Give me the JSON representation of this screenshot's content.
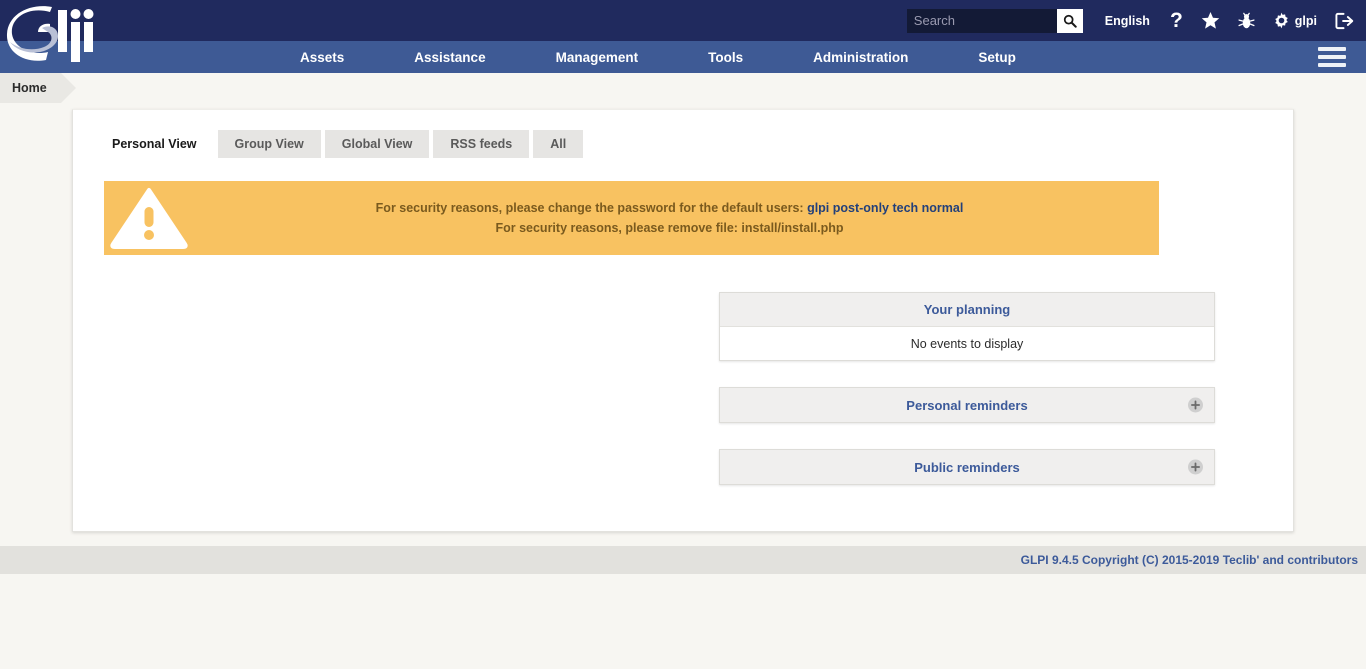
{
  "app": {
    "logo_text": "glpi",
    "name": "GLPI"
  },
  "topbar": {
    "search": {
      "placeholder": "Search",
      "value": "",
      "button_icon": "search-icon"
    },
    "language": "English",
    "icons": {
      "help": "?",
      "help_name": "help-icon",
      "favorites_name": "star-icon",
      "bug_name": "bug-icon",
      "settings_name": "gear-icon",
      "logout_name": "logout-icon"
    },
    "user": "glpi"
  },
  "nav": {
    "items": [
      {
        "label": "Assets"
      },
      {
        "label": "Assistance"
      },
      {
        "label": "Management"
      },
      {
        "label": "Tools"
      },
      {
        "label": "Administration"
      },
      {
        "label": "Setup"
      }
    ],
    "menu_icon": "hamburger-menu-icon"
  },
  "breadcrumb": {
    "current": "Home"
  },
  "tabs": [
    {
      "label": "Personal View",
      "active": true
    },
    {
      "label": "Group View",
      "active": false
    },
    {
      "label": "Global View",
      "active": false
    },
    {
      "label": "RSS feeds",
      "active": false
    },
    {
      "label": "All",
      "active": false
    }
  ],
  "warning": {
    "icon": "warning-triangle-icon",
    "line1_prefix": "For security reasons, please change the password for the default users:",
    "line1_link": "glpi post-only tech normal",
    "line2": "For security reasons, please remove file: install/install.php",
    "bg_color": "#f8c261",
    "text_color": "#7a5a1e",
    "link_color": "#23407a"
  },
  "widgets": [
    {
      "title": "Your planning",
      "body": "No events to display",
      "has_body": true,
      "has_add": false
    },
    {
      "title": "Personal reminders",
      "body": "",
      "has_body": false,
      "has_add": true,
      "add_icon": "plus-icon"
    },
    {
      "title": "Public reminders",
      "body": "",
      "has_body": false,
      "has_add": true,
      "add_icon": "plus-icon"
    }
  ],
  "footer": {
    "text": "GLPI 9.4.5 Copyright (C) 2015-2019 Teclib' and contributors"
  },
  "colors": {
    "topbar_bg": "#202a5e",
    "navbar_bg": "#3e5a95",
    "page_bg": "#f7f6f2",
    "accent_blue": "#3c5a9a",
    "warning_bg": "#f8c261",
    "footer_bg": "#e2e1dd"
  }
}
